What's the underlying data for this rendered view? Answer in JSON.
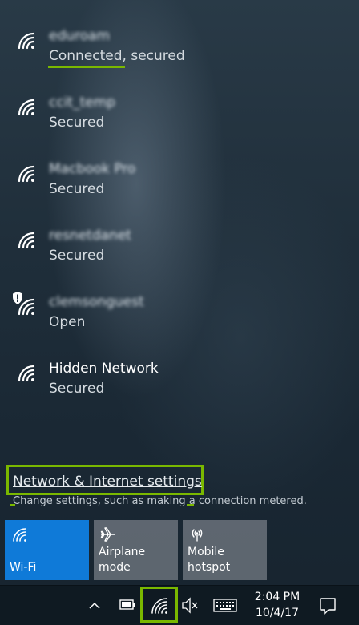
{
  "networks": [
    {
      "name": "eduroam",
      "status": "Connected, secured",
      "blurred": true
    },
    {
      "name": "ccit_temp",
      "status": "Secured",
      "blurred": true
    },
    {
      "name": "Macbook Pro",
      "status": "Secured",
      "blurred": true
    },
    {
      "name": "resnetdanet",
      "status": "Secured",
      "blurred": true
    },
    {
      "name": "clemsonguest",
      "status": "Open",
      "blurred": true
    },
    {
      "name": "Hidden Network",
      "status": "Secured",
      "blurred": false
    }
  ],
  "settings": {
    "link": "Network & Internet settings",
    "description": "Change settings, such as making a connection metered."
  },
  "quick_actions": [
    {
      "label": "Wi-Fi",
      "icon": "wifi-icon"
    },
    {
      "label": "Airplane mode",
      "icon": "airplane-icon"
    },
    {
      "label": "Mobile hotspot",
      "icon": "hotspot-icon"
    }
  ],
  "taskbar": {
    "time": "2:04 PM",
    "date": "10/4/17"
  },
  "colors": {
    "accent": "#0f7ad8",
    "highlight": "#7ab800"
  }
}
